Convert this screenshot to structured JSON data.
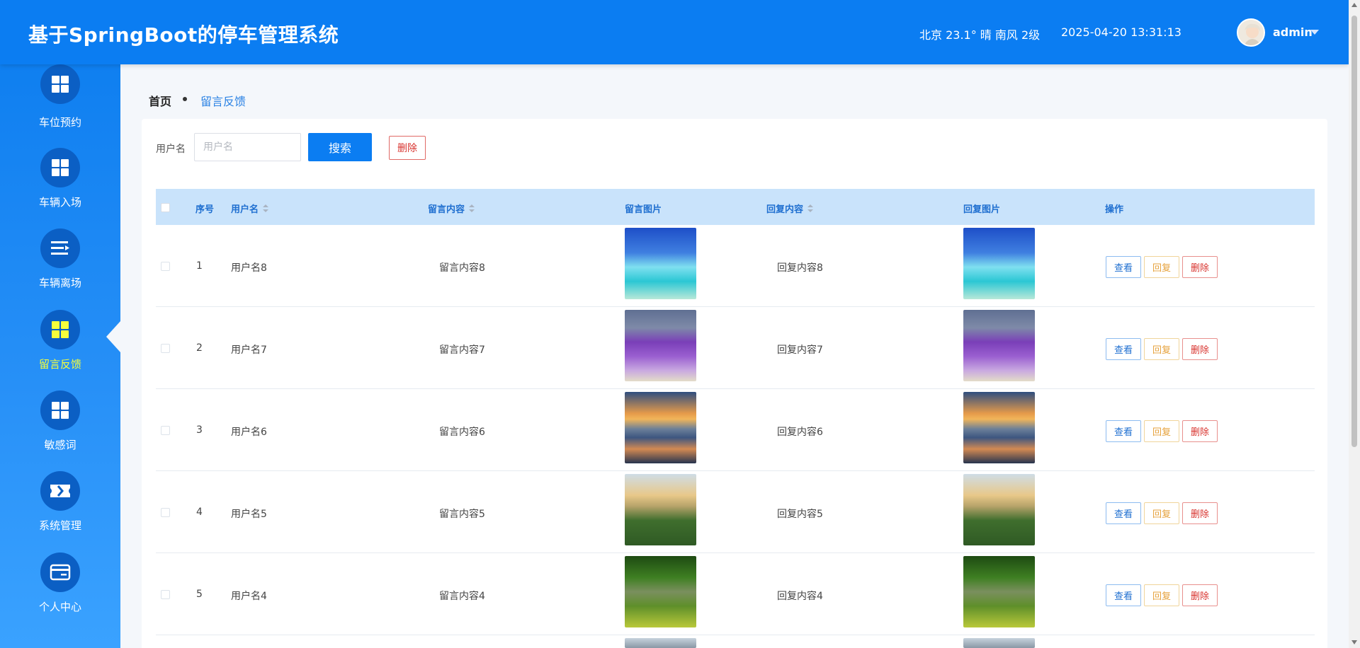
{
  "header": {
    "title": "基于SpringBoot的停车管理系统",
    "weather": "北京  23.1°  晴  南风  2级",
    "datetime": "2025-04-20 13:31:13",
    "user": "admin"
  },
  "sidebar": {
    "items": [
      {
        "label": "车位预约",
        "icon": "grid-icon",
        "active": false
      },
      {
        "label": "车辆入场",
        "icon": "grid-icon",
        "active": false
      },
      {
        "label": "车辆离场",
        "icon": "list-icon",
        "active": false
      },
      {
        "label": "留言反馈",
        "icon": "grid-icon",
        "active": true
      },
      {
        "label": "敏感词",
        "icon": "grid-icon",
        "active": false
      },
      {
        "label": "系统管理",
        "icon": "ticket-icon",
        "active": false
      },
      {
        "label": "个人中心",
        "icon": "card-icon",
        "active": false
      }
    ]
  },
  "breadcrumb": {
    "home": "首页",
    "current": "留言反馈"
  },
  "search": {
    "label": "用户名",
    "placeholder": "用户名",
    "button": "搜索",
    "delete": "删除"
  },
  "table": {
    "columns": [
      "序号",
      "用户名",
      "留言内容",
      "留言图片",
      "回复内容",
      "回复图片",
      "操作"
    ],
    "actions": {
      "view": "查看",
      "reply": "回复",
      "delete": "删除"
    },
    "rows": [
      {
        "index": "1",
        "username": "用户名8",
        "content": "留言内容8",
        "reply": "回复内容8",
        "image": "beach-image"
      },
      {
        "index": "2",
        "username": "用户名7",
        "content": "留言内容7",
        "reply": "回复内容7",
        "image": "lavender-image"
      },
      {
        "index": "3",
        "username": "用户名6",
        "content": "留言内容6",
        "reply": "回复内容6",
        "image": "mountain-image"
      },
      {
        "index": "4",
        "username": "用户名5",
        "content": "留言内容5",
        "reply": "回复内容5",
        "image": "sunset-image"
      },
      {
        "index": "5",
        "username": "用户名4",
        "content": "留言内容4",
        "reply": "回复内容4",
        "image": "bridge-image"
      }
    ]
  },
  "colors": {
    "primary": "#0b7df2",
    "active_nav": "#f6ff3b",
    "table_header": "#c9e3fb",
    "danger": "#d8332e",
    "warning": "#e6a23c"
  }
}
